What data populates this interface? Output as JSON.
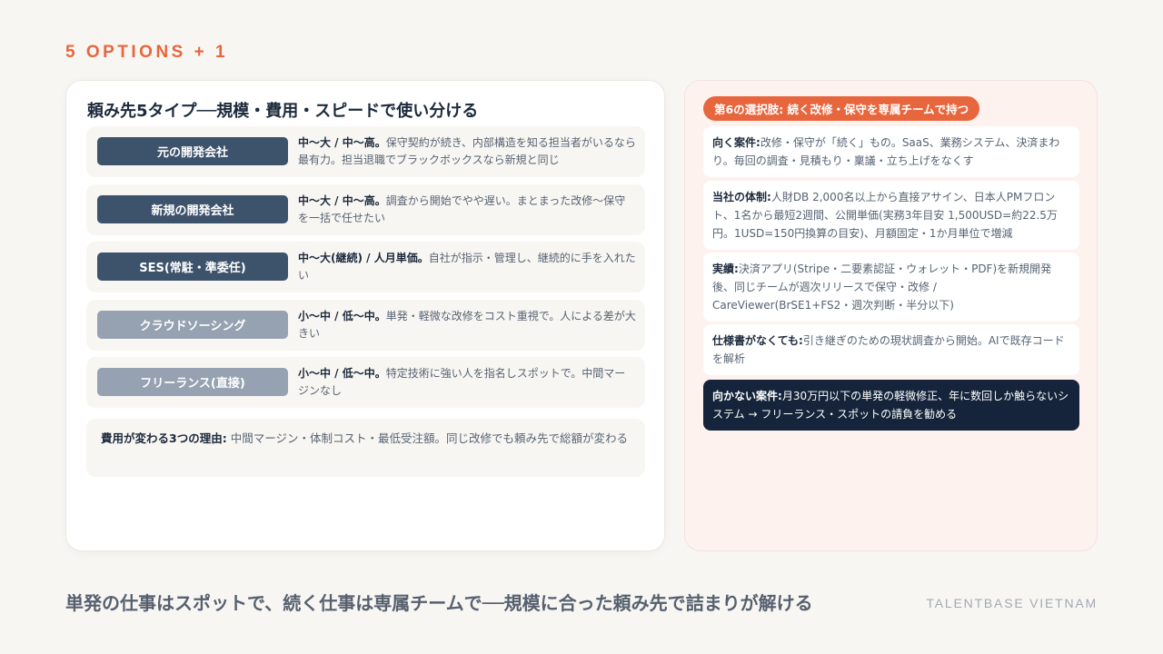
{
  "eyebrow": "5 OPTIONS + 1",
  "left": {
    "title": "頼み先5タイプ──規模・費用・スピードで使い分ける",
    "types": [
      {
        "name": "元の開発会社",
        "tone": "dark",
        "summary": "中〜大 / 中〜高。",
        "detail": "保守契約が続き、内部構造を知る担当者がいるなら最有力。担当退職でブラックボックスなら新規と同じ"
      },
      {
        "name": "新規の開発会社",
        "tone": "dark",
        "summary": "中〜大 / 中〜高。",
        "detail": "調査から開始でやや遅い。まとまった改修〜保守を一括で任せたい"
      },
      {
        "name": "SES(常駐・準委任)",
        "tone": "dark",
        "summary": "中〜大(継続) / 人月単価。",
        "detail": "自社が指示・管理し、継続的に手を入れたい"
      },
      {
        "name": "クラウドソーシング",
        "tone": "light",
        "summary": "小〜中 / 低〜中。",
        "detail": "単発・軽微な改修をコスト重視で。人による差が大きい"
      },
      {
        "name": "フリーランス(直接)",
        "tone": "light",
        "summary": "小〜中 / 低〜中。",
        "detail": "特定技術に強い人を指名しスポットで。中間マージンなし"
      }
    ],
    "cost": {
      "label": "費用が変わる3つの理由:",
      "text": "中間マージン・体制コスト・最低受注額。同じ改修でも頼み先で総額が変わる"
    }
  },
  "right": {
    "pill": "第6の選択肢: 続く改修・保守を専属チームで持つ",
    "boxes": [
      {
        "label": "向く案件:",
        "text": "改修・保守が「続く」もの。SaaS、業務システム、決済まわり。毎回の調査・見積もり・稟議・立ち上げをなくす"
      },
      {
        "label": "当社の体制:",
        "text": "人財DB 2,000名以上から直接アサイン、日本人PMフロント、1名から最短2週間、公開単価(実務3年目安 1,500USD=約22.5万円。1USD=150円換算の目安)、月額固定・1か月単位で増減"
      },
      {
        "label": "実績:",
        "text": "決済アプリ(Stripe・二要素認証・ウォレット・PDF)を新規開発後、同じチームが週次リリースで保守・改修 / CareViewer(BrSE1+FS2・週次判断・半分以下)"
      },
      {
        "label": "仕様書がなくても:",
        "text": "引き継ぎのための現状調査から開始。AIで既存コードを解析"
      }
    ],
    "not_fit": {
      "label": "向かない案件:",
      "text": "月30万円以下の単発の軽微修正、年に数回しか触らないシステム → フリーランス・スポットの請負を勧める"
    }
  },
  "footer": {
    "message": "単発の仕事はスポットで、続く仕事は専属チームで──規模に合った頼み先で詰まりが解ける",
    "brand": "TALENTBASE VIETNAM"
  },
  "colors": {
    "accent": "#e8663d",
    "navy": "#15243a",
    "badge_dark": "#3d536c",
    "badge_light": "#96a2b1"
  }
}
